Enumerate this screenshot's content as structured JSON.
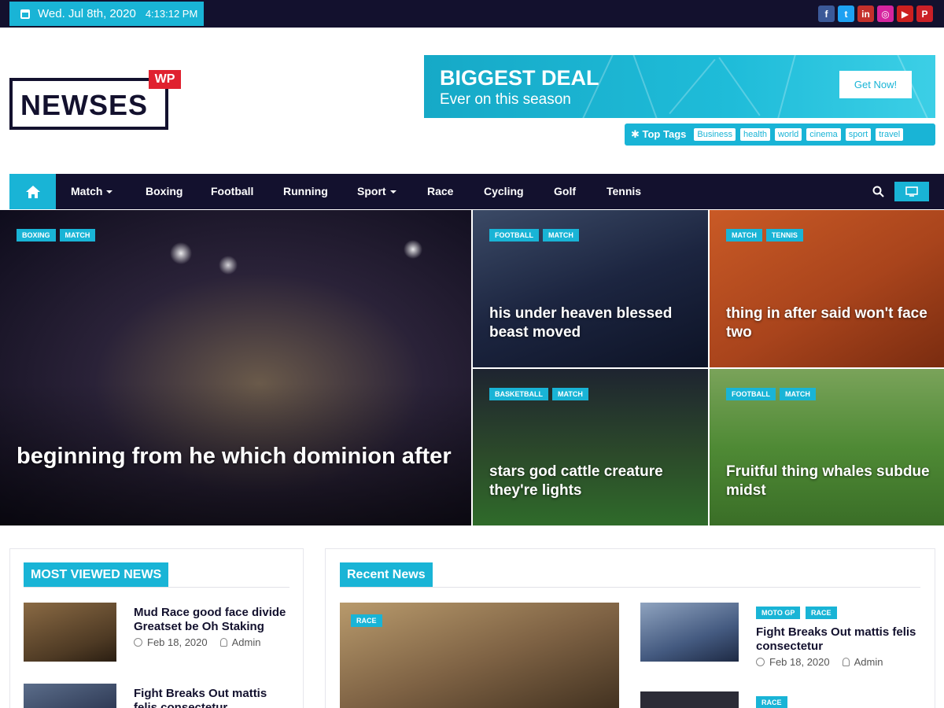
{
  "topbar": {
    "date": "Wed. Jul 8th, 2020",
    "time": "4:13:12 PM",
    "socials": [
      {
        "icon": "facebook-icon",
        "glyph": "f",
        "color": "#3b5998"
      },
      {
        "icon": "twitter-icon",
        "glyph": "t",
        "color": "#1da1f2"
      },
      {
        "icon": "linkedin-icon",
        "glyph": "in",
        "color": "#c4302b"
      },
      {
        "icon": "instagram-icon",
        "glyph": "◎",
        "color": "#d6249f"
      },
      {
        "icon": "youtube-icon",
        "glyph": "▶",
        "color": "#cd201f"
      },
      {
        "icon": "pinterest-icon",
        "glyph": "P",
        "color": "#cb2027"
      }
    ]
  },
  "logo": {
    "text": "NEWSES",
    "badge": "WP"
  },
  "banner": {
    "headline": "BIGGEST DEAL",
    "subline": "Ever on this season",
    "button": "Get Now!"
  },
  "top_tags": {
    "label": "Top Tags",
    "tags": [
      "Business",
      "health",
      "world",
      "cinema",
      "sport",
      "travel"
    ]
  },
  "nav": {
    "items": [
      "Match",
      "Boxing",
      "Football",
      "Running",
      "Sport",
      "Race",
      "Cycling",
      "Golf",
      "Tennis"
    ],
    "dropdown": [
      "Match",
      "Sport"
    ]
  },
  "hero": {
    "main": {
      "categories": [
        "BOXING",
        "MATCH"
      ],
      "title": "beginning from he which dominion after"
    },
    "tiles": [
      {
        "categories": [
          "FOOTBALL",
          "MATCH"
        ],
        "title": "his under heaven blessed beast moved"
      },
      {
        "categories": [
          "MATCH",
          "TENNIS"
        ],
        "title": "thing in after said won't face two"
      },
      {
        "categories": [
          "BASKETBALL",
          "MATCH"
        ],
        "title": "stars god cattle creature they're lights"
      },
      {
        "categories": [
          "FOOTBALL",
          "MATCH"
        ],
        "title": "Fruitful thing whales subdue midst"
      }
    ]
  },
  "most_viewed": {
    "heading": "MOST VIEWED NEWS",
    "items": [
      {
        "title": "Mud Race good face divide Greatset be Oh Staking",
        "date": "Feb 18, 2020",
        "author": "Admin"
      },
      {
        "title": "Fight Breaks Out mattis felis consectetur",
        "date": "",
        "author": ""
      }
    ]
  },
  "recent": {
    "heading": "Recent News",
    "feature": {
      "category": "RACE"
    },
    "items": [
      {
        "categories": [
          "MOTO GP",
          "RACE"
        ],
        "title": "Fight Breaks Out mattis felis consectetur",
        "date": "Feb 18, 2020",
        "author": "Admin"
      },
      {
        "categories": [
          "RACE"
        ]
      }
    ]
  }
}
